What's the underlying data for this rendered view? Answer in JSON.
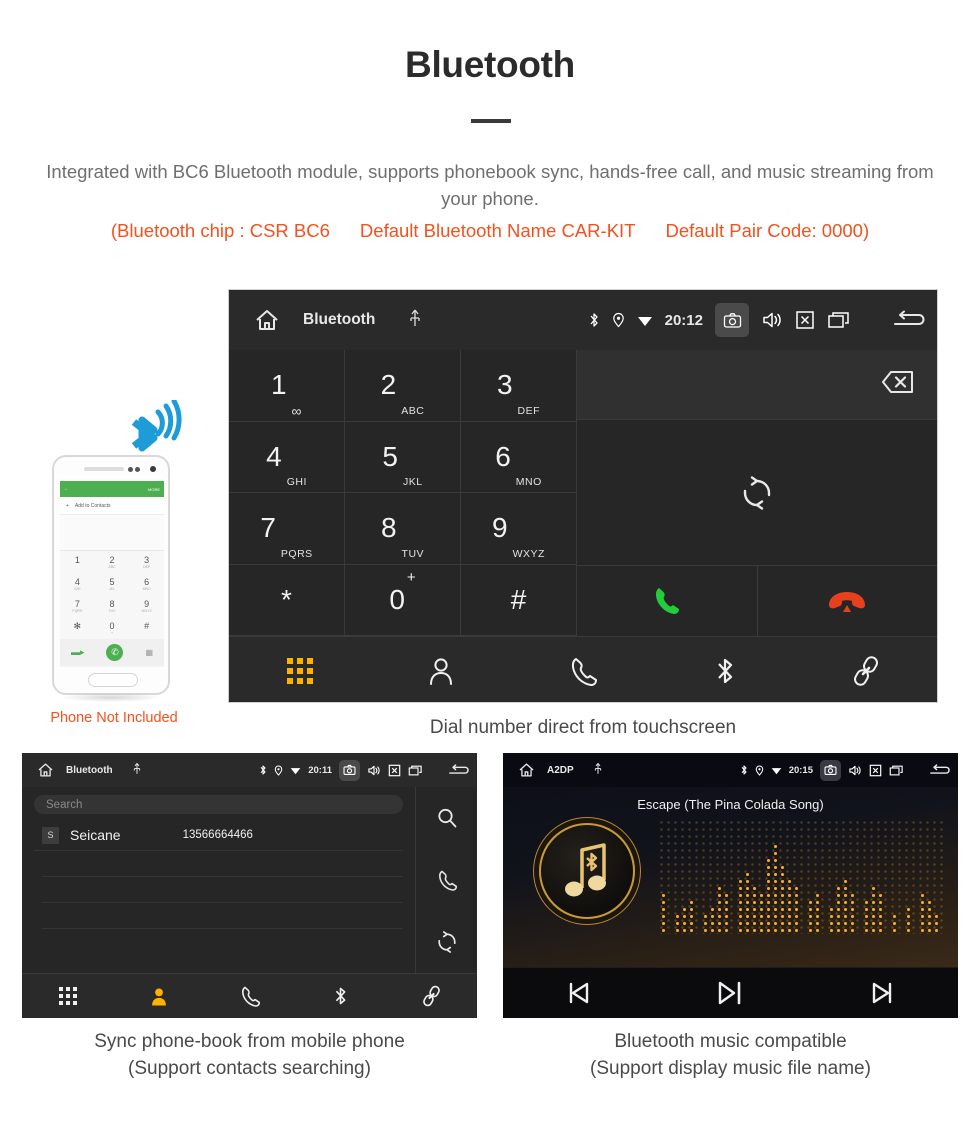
{
  "header": {
    "title": "Bluetooth",
    "description": "Integrated with BC6 Bluetooth module, supports phonebook sync, hands-free call, and music streaming from your phone.",
    "specs": [
      "(Bluetooth chip : CSR BC6",
      "Default Bluetooth Name CAR-KIT",
      "Default Pair Code: 0000)"
    ],
    "accent_color": "#f4511e",
    "text_color": "#6f6f6f"
  },
  "dialer_unit": {
    "statusbar": {
      "home_icon": "home-icon",
      "title": "Bluetooth",
      "usb_icon": "usb-icon",
      "bluetooth_icon": "bluetooth-icon",
      "location_icon": "location-icon",
      "wifi_icon": "wifi-icon",
      "time": "20:12",
      "camera_icon": "camera-icon",
      "volume_icon": "volume-icon",
      "close_icon": "close-box-icon",
      "recents_icon": "recents-icon",
      "back_icon": "back-icon"
    },
    "keys": [
      {
        "num": "1",
        "sub": "∞",
        "is_voicemail": true
      },
      {
        "num": "2",
        "sub": "ABC"
      },
      {
        "num": "3",
        "sub": "DEF"
      },
      {
        "num": "4",
        "sub": "GHI"
      },
      {
        "num": "5",
        "sub": "JKL"
      },
      {
        "num": "6",
        "sub": "MNO"
      },
      {
        "num": "7",
        "sub": "PQRS"
      },
      {
        "num": "8",
        "sub": "TUV"
      },
      {
        "num": "9",
        "sub": "WXYZ"
      },
      {
        "num": "*",
        "sub": ""
      },
      {
        "num": "0",
        "sup": "+"
      },
      {
        "num": "#",
        "sub": ""
      }
    ],
    "number_display": "",
    "backspace_icon": "backspace-icon",
    "sync_icon": "sync-icon",
    "call_icon": "call-icon",
    "hangup_icon": "hangup-icon",
    "call_color": "#22cc3a",
    "hangup_color": "#e8401c",
    "nav": [
      {
        "icon": "dialpad-icon",
        "active": true
      },
      {
        "icon": "contacts-icon",
        "active": false
      },
      {
        "icon": "call-history-icon",
        "active": false
      },
      {
        "icon": "bluetooth-icon",
        "active": false
      },
      {
        "icon": "pair-link-icon",
        "active": false
      }
    ],
    "active_color": "#ffb300",
    "caption": "Dial number direct from touchscreen"
  },
  "phone_illustration": {
    "bluetooth_signal_icon": "bluetooth-signal-icon",
    "signal_color": "#1e9cd7",
    "app_bar_back": "←",
    "app_bar_more": "MORE",
    "add_to_contacts": "Add to Contacts",
    "add_icon": "plus-icon",
    "keys": [
      {
        "num": "1",
        "sub": ""
      },
      {
        "num": "2",
        "sub": "ABC"
      },
      {
        "num": "3",
        "sub": "DEF"
      },
      {
        "num": "4",
        "sub": "GHI"
      },
      {
        "num": "5",
        "sub": "JKL"
      },
      {
        "num": "6",
        "sub": "MNO"
      },
      {
        "num": "7",
        "sub": "PQRS"
      },
      {
        "num": "8",
        "sub": "TUV"
      },
      {
        "num": "9",
        "sub": "WXYZ"
      },
      {
        "num": "✳",
        "sub": ""
      },
      {
        "num": "0",
        "sub": "+"
      },
      {
        "num": "#",
        "sub": ""
      }
    ],
    "call_icon": "call-icon",
    "note": "Phone Not Included",
    "note_color": "#f4511e"
  },
  "phonebook_unit": {
    "statusbar": {
      "home_icon": "home-icon",
      "title": "Bluetooth",
      "usb_icon": "usb-icon",
      "time": "20:11",
      "camera_icon": "camera-icon",
      "volume_icon": "volume-icon",
      "close_icon": "close-box-icon",
      "recents_icon": "recents-icon",
      "back_icon": "back-icon"
    },
    "search_placeholder": "Search",
    "search_value": "",
    "contacts": [
      {
        "initial": "S",
        "name": "Seicane",
        "number": "13566664466"
      }
    ],
    "side_buttons": [
      {
        "icon": "search-icon"
      },
      {
        "icon": "call-icon"
      },
      {
        "icon": "sync-icon"
      }
    ],
    "nav": [
      {
        "icon": "dialpad-icon",
        "active": false
      },
      {
        "icon": "contacts-icon",
        "active": true
      },
      {
        "icon": "call-history-icon",
        "active": false
      },
      {
        "icon": "bluetooth-icon",
        "active": false
      },
      {
        "icon": "pair-link-icon",
        "active": false
      }
    ],
    "caption_line1": "Sync phone-book from mobile phone",
    "caption_line2": "(Support contacts searching)"
  },
  "music_unit": {
    "statusbar": {
      "home_icon": "home-icon",
      "title": "A2DP",
      "usb_icon": "usb-icon",
      "time": "20:15",
      "camera_icon": "camera-icon",
      "volume_icon": "volume-icon",
      "close_icon": "close-box-icon",
      "recents_icon": "recents-icon",
      "back_icon": "back-icon"
    },
    "song_title": "Escape (The Pina Colada Song)",
    "album_icon": "music-note-bluetooth-icon",
    "visualizer_icon": "audio-visualizer",
    "controls": [
      {
        "icon": "previous-track-icon"
      },
      {
        "icon": "play-pause-icon"
      },
      {
        "icon": "next-track-icon"
      }
    ],
    "accent_color": "#ffb030",
    "caption_line1": "Bluetooth music compatible",
    "caption_line2": "(Support display music file name)"
  }
}
